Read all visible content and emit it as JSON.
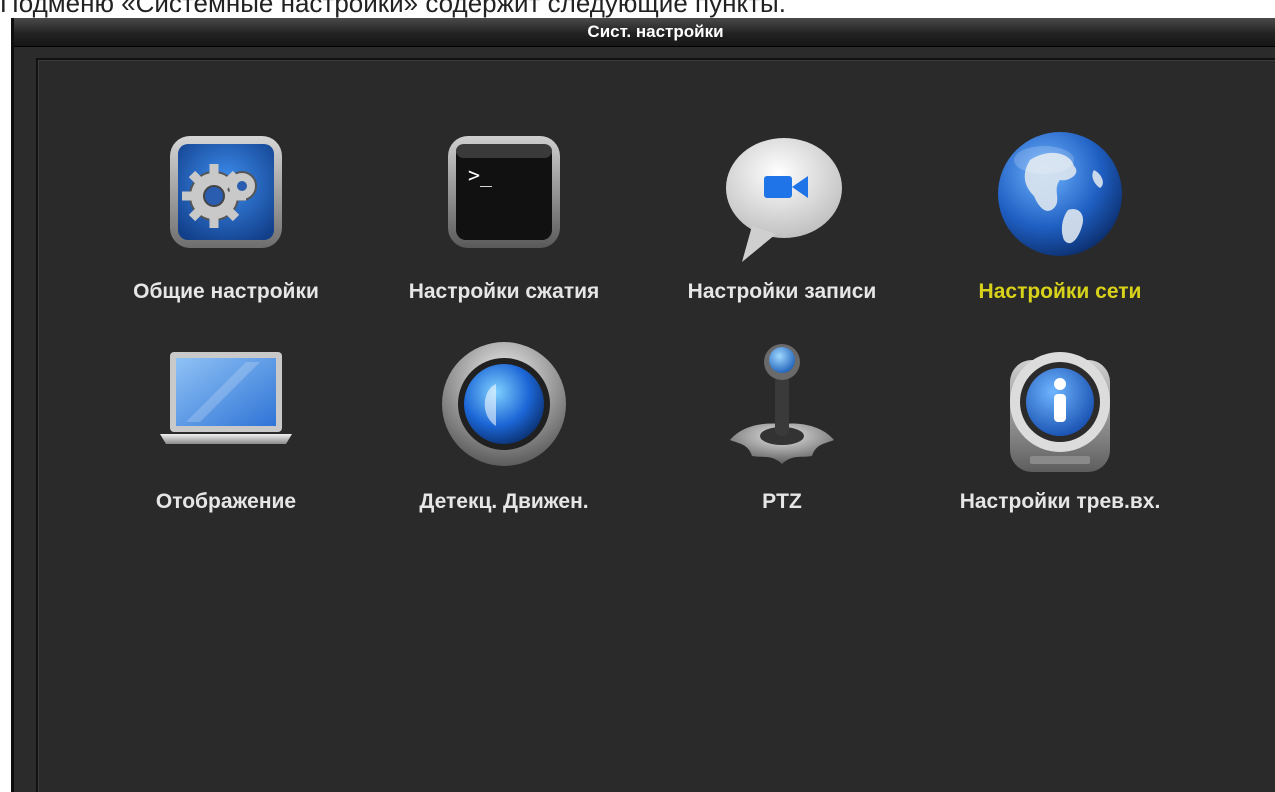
{
  "document": {
    "caption_line": "Подменю «Системные настройки» содержит следующие пункты."
  },
  "window": {
    "title": "Сист. настройки"
  },
  "menu": {
    "selected_color": "#d8d21a",
    "label_color": "#e6e6e6",
    "items": [
      {
        "label": "Общие настройки",
        "icon": "gear-icon",
        "selected": false
      },
      {
        "label": "Настройки сжатия",
        "icon": "terminal-icon",
        "selected": false
      },
      {
        "label": "Настройки записи",
        "icon": "video-chat-icon",
        "selected": false
      },
      {
        "label": "Настройки сети",
        "icon": "globe-icon",
        "selected": true
      },
      {
        "label": "Отображение",
        "icon": "laptop-icon",
        "selected": false
      },
      {
        "label": "Детекц. Движен.",
        "icon": "motion-lens-icon",
        "selected": false
      },
      {
        "label": "PTZ",
        "icon": "joystick-icon",
        "selected": false
      },
      {
        "label": "Настройки трев.вх.",
        "icon": "alarm-info-icon",
        "selected": false
      }
    ]
  }
}
